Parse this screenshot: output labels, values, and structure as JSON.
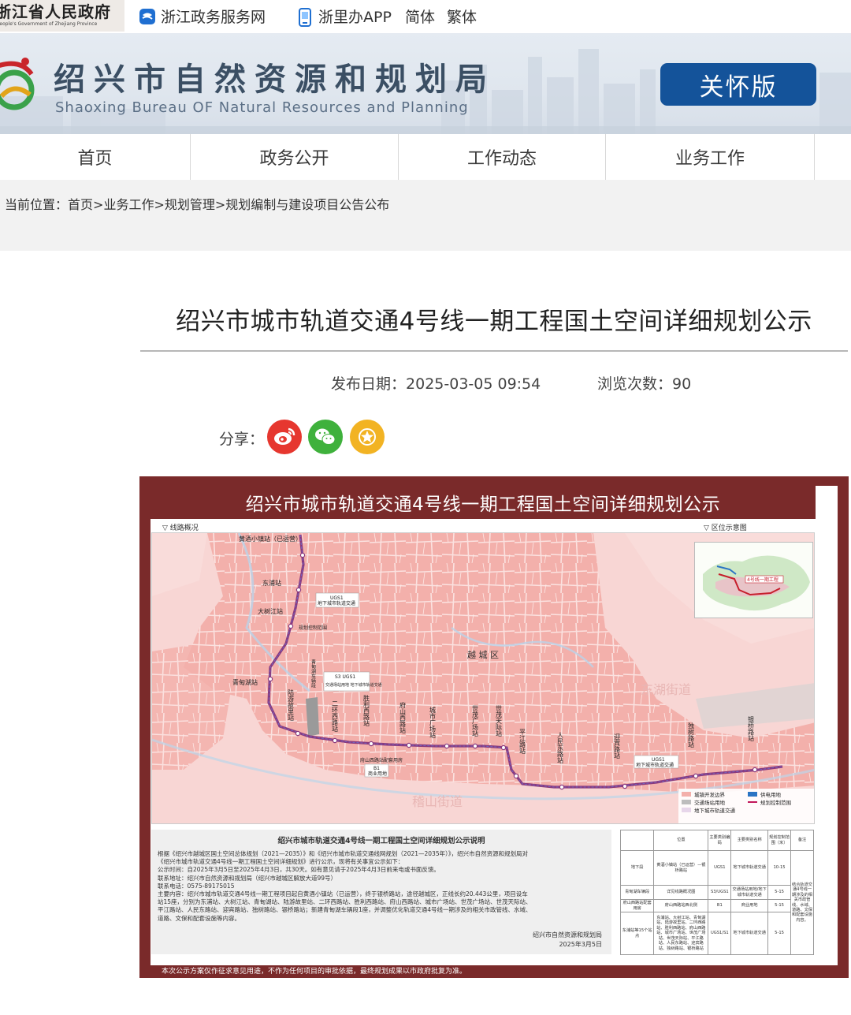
{
  "topbar": {
    "gov_logo_zh": "浙江省人民政府",
    "gov_logo_en": "People's Government of Zhejiang Province",
    "links": {
      "service": "浙江政务服务网",
      "app": "浙里办APP",
      "simplified": "简体",
      "traditional": "繁体"
    }
  },
  "banner": {
    "title_zh": "绍兴市自然资源和规划局",
    "title_en": "Shaoxing Bureau OF Natural Resources and Planning",
    "care_button": "关怀版"
  },
  "nav": {
    "items": [
      "首页",
      "政务公开",
      "工作动态",
      "业务工作"
    ]
  },
  "breadcrumb": {
    "prefix": "当前位置：",
    "items": [
      "首页",
      "业务工作",
      "规划管理",
      "规划编制与建设项目公告公布"
    ],
    "sep": ">"
  },
  "article": {
    "title": "绍兴市城市轨道交通4号线一期工程国土空间详细规划公示",
    "date_label": "发布日期：",
    "date": "2025-03-05 09:54",
    "views_label": "浏览次数：",
    "views": "90",
    "share_label": "分享："
  },
  "poster": {
    "banner_title": "绍兴市城市轨道交通4号线一期工程国土空间详细规划公示",
    "map_label_left": "▽ 线路概况",
    "map_label_right": "▽ 区位示意图",
    "map": {
      "district": "越 城 区",
      "street1": "东湖街道",
      "street2": "稽山街道",
      "stations": [
        "黄酒小镇站（已运营）",
        "东浦站",
        "大树江站",
        "青甸湖站",
        "陆游故里站",
        "二环西路站",
        "胜利西路站",
        "府山西路站",
        "城市广场站",
        "世茂广场站",
        "世茂天际站",
        "平江路站",
        "人民东路站",
        "迎宾路站",
        "独树路站",
        "银桥路站"
      ],
      "notes": {
        "ugs1_top": "UGS1",
        "ugs1_top_text": "地下城市轨道交通",
        "depot_line": "规划控制范围",
        "depot_title": "青甸湖车辆段",
        "s3": "S3 UGS1",
        "s3_text": "交通场站用地 地下城市轨道交通",
        "b1": "B1",
        "b1_text": "商业用地",
        "b1_title": "府山西路站配套用房",
        "ugs1_east": "UGS1",
        "ugs1_east_text": "地下城市轨道交通"
      },
      "inset_label": "4号线一期工程",
      "legend": {
        "a": "城镇开发边界",
        "b": "交通场站用地",
        "c": "地下城市轨道交通",
        "d": "供电用地",
        "e": "规划控制范围"
      }
    },
    "desc": {
      "heading": "绍兴市城市轨道交通4号线一期工程国土空间详细规划公示说明",
      "lines": [
        "根据《绍兴市越城区国土空间总体规划（2021—2035）》和《绍兴市城市轨道交通线网规划（2021—2035年）》，绍兴市自然资源和规划局对",
        "《绍兴市城市轨道交通4号线一期工程国土空间详细规划》进行公示，现将有关事宜公示如下：",
        "公示时间：自2025年3月5日至2025年4月3日，共30天。如有意见请于2025年4月3日前来电或书面反馈。",
        "联系地址：绍兴市自然资源和规划局（绍兴市越城区解放大道99号）",
        "联系电话：0575-89175015",
        "主要内容：绍兴市城市轨道交通4号线一期工程项目起自黄酒小镇站（已运营），终于银桥路站，途径越城区，正线长约20.443公里，项目设车",
        "站15座，分别为东浦站、大树江站、青甸湖站、陆游故里站、二环西路站、胜利西路站、府山西路站、城市广场站、世茂广场站、世茂天际站、",
        "平江路站、人民东路站、迎宾路站、独树路站、银桥路站；新建青甸湖车辆段1座，并调整优化轨道交通4号线一期涉及的相关市政管线、水域、",
        "道路、文保和配套设施等内容。"
      ],
      "sign_org": "绍兴市自然资源和规划局",
      "sign_date": "2025年3月5日"
    },
    "table": {
      "headers": [
        "",
        "位置",
        "主要类别编码",
        "主要类别名称",
        "规划控制范围（米）",
        "备注"
      ],
      "rows": [
        [
          "地下段",
          "黄酒小镇站（已运营）—银桥路站",
          "UGS1",
          "地下城市轨道交通",
          "10-15"
        ],
        [
          "青甸湖车辆段",
          "详见线路概况图",
          "S3/UGS1",
          "交通场站用地/地下城市轨道交通",
          "5-15"
        ],
        [
          "府山西路站配套用房",
          "府山西路站西北侧",
          "B1",
          "商业用地",
          "5-15"
        ],
        [
          "东浦站等15个站点",
          "东浦站、大树江站、青甸湖站、陆游故里站、二环西路站、胜利西路站、府山西路站、城市广场站、世茂广场站、世茂天际站、平江路站、人民东路站、迎宾路站、独树路站、银桥路站",
          "UGS1/S1",
          "地下城市轨道交通",
          "5-15"
        ]
      ],
      "remark": "结合轨道交通4号线一期涉及的相关市政管线、水域、道路、文保和配套设施内容。"
    },
    "footnote": "本次公示方案仅作征求意见用途，不作为任何项目的审批依据，最终规划成果以市政府批复为准。"
  },
  "colors": {
    "brand_blue": "#14539a",
    "poster_frame": "#7a2a2a",
    "map_fill": "#f2a9a4",
    "rail_line": "#8a3a7e"
  }
}
